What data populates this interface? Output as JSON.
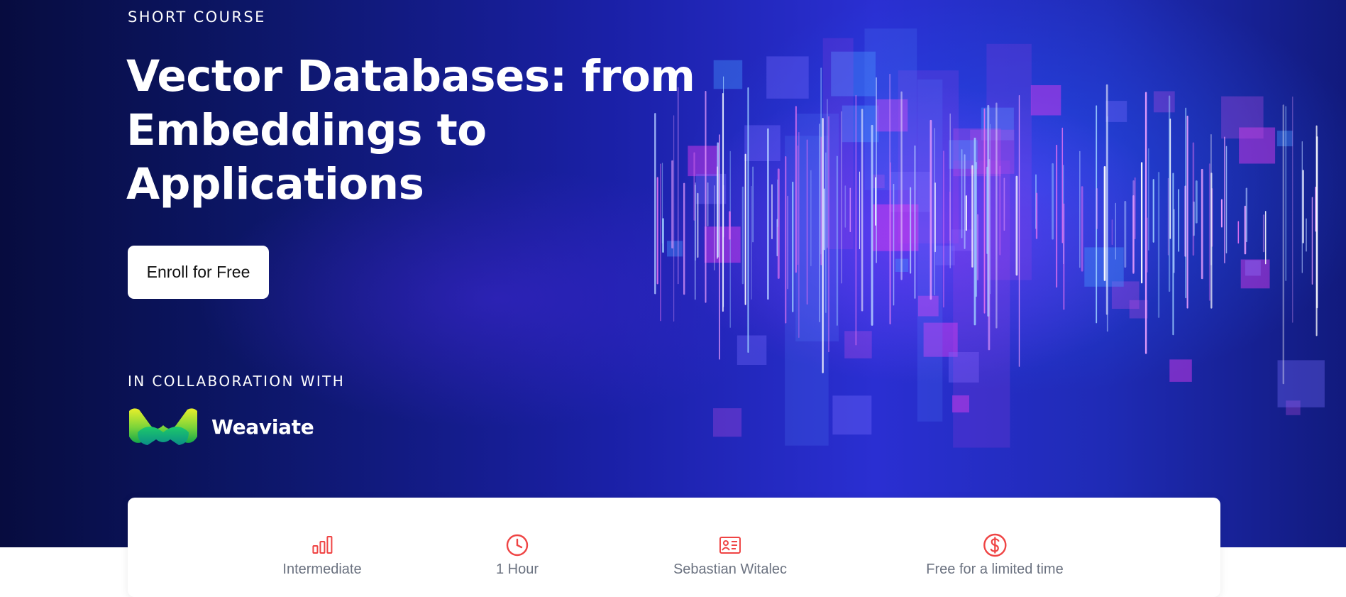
{
  "hero": {
    "eyebrow": "SHORT COURSE",
    "title": "Vector Databases: from Embeddings to Applications",
    "enroll_label": "Enroll for Free",
    "collab_label": "IN COLLABORATION WITH",
    "partner_name": "Weaviate"
  },
  "info": {
    "level": "Intermediate",
    "duration": "1 Hour",
    "instructor": "Sebastian Witalec",
    "price": "Free for a limited time"
  },
  "colors": {
    "accent": "#ef4444",
    "hero_bg": "#1a20a6",
    "muted_text": "#6b7280"
  },
  "icons": {
    "level": "bar-chart-icon",
    "duration": "clock-icon",
    "instructor": "instructor-icon",
    "price": "dollar-icon"
  }
}
